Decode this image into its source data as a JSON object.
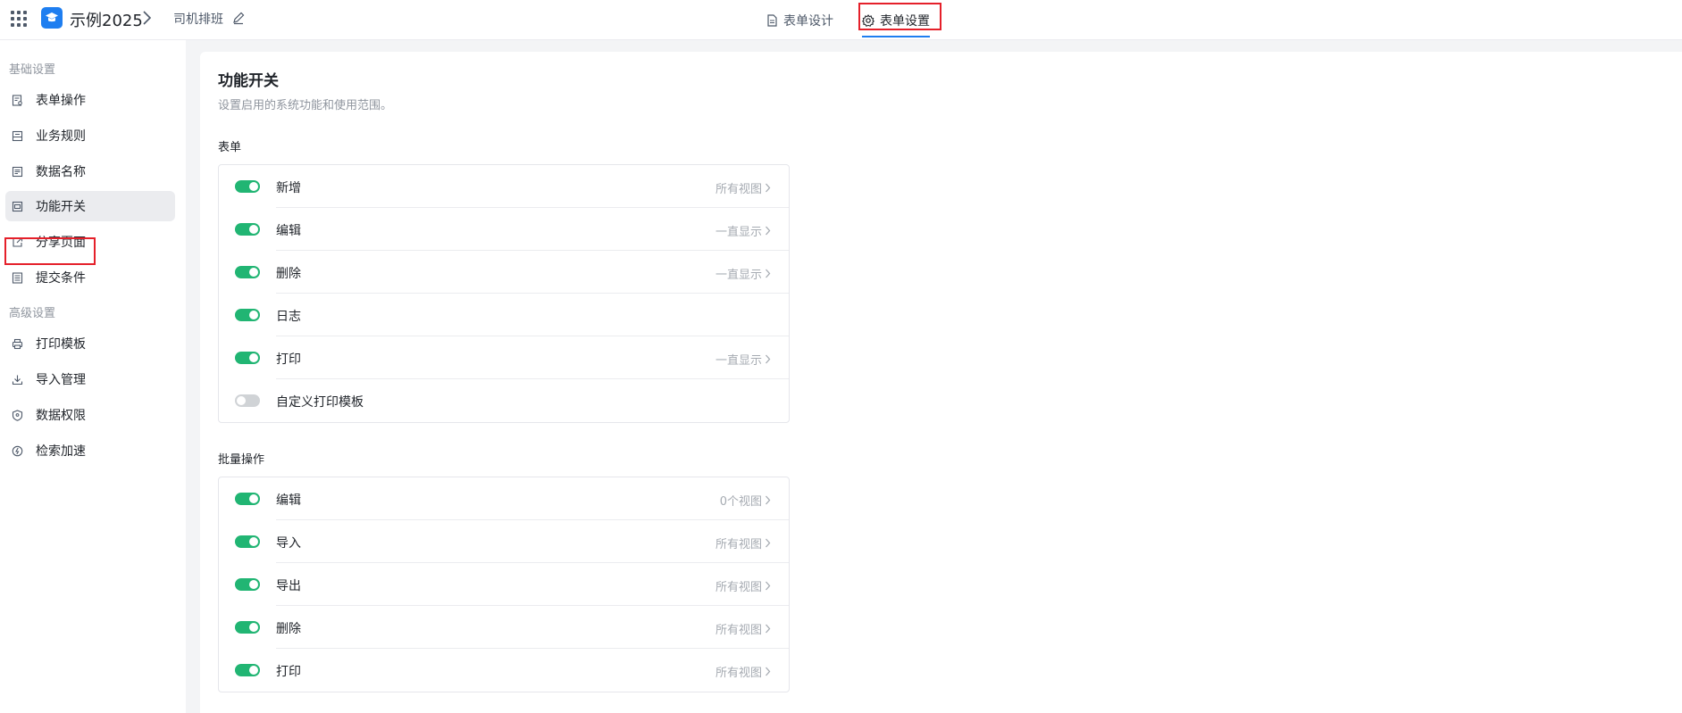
{
  "header": {
    "app_name": "示例2025",
    "form_name": "司机排班",
    "tabs": [
      {
        "label": "表单设计",
        "icon": "document-icon",
        "active": false
      },
      {
        "label": "表单设置",
        "icon": "gear-icon",
        "active": true
      }
    ]
  },
  "sidebar": {
    "groups": [
      {
        "title": "基础设置",
        "items": [
          {
            "label": "表单操作",
            "icon": "form-op-icon"
          },
          {
            "label": "业务规则",
            "icon": "rule-icon"
          },
          {
            "label": "数据名称",
            "icon": "data-name-icon"
          },
          {
            "label": "功能开关",
            "icon": "switch-icon",
            "active": true
          },
          {
            "label": "分享页面",
            "icon": "share-icon"
          },
          {
            "label": "提交条件",
            "icon": "submit-condition-icon"
          }
        ]
      },
      {
        "title": "高级设置",
        "items": [
          {
            "label": "打印模板",
            "icon": "printer-icon"
          },
          {
            "label": "导入管理",
            "icon": "download-icon"
          },
          {
            "label": "数据权限",
            "icon": "shield-icon"
          },
          {
            "label": "检索加速",
            "icon": "speed-icon"
          }
        ]
      }
    ]
  },
  "main": {
    "title": "功能开关",
    "subtitle": "设置启用的系统功能和使用范围。",
    "sections": [
      {
        "title": "表单",
        "rows": [
          {
            "label": "新增",
            "value": "所有视图",
            "enabled": true
          },
          {
            "label": "编辑",
            "value": "一直显示",
            "enabled": true
          },
          {
            "label": "删除",
            "value": "一直显示",
            "enabled": true
          },
          {
            "label": "日志",
            "value": "",
            "enabled": true
          },
          {
            "label": "打印",
            "value": "一直显示",
            "enabled": true
          },
          {
            "label": "自定义打印模板",
            "value": "",
            "enabled": false
          }
        ]
      },
      {
        "title": "批量操作",
        "rows": [
          {
            "label": "编辑",
            "value": "0个视图",
            "enabled": true
          },
          {
            "label": "导入",
            "value": "所有视图",
            "enabled": true
          },
          {
            "label": "导出",
            "value": "所有视图",
            "enabled": true
          },
          {
            "label": "删除",
            "value": "所有视图",
            "enabled": true
          },
          {
            "label": "打印",
            "value": "所有视图",
            "enabled": true
          }
        ]
      }
    ]
  },
  "colors": {
    "accent": "#1e7ef0",
    "toggle_on": "#21b573",
    "toggle_off": "#d0d3d6",
    "highlight": "#e5202a"
  }
}
